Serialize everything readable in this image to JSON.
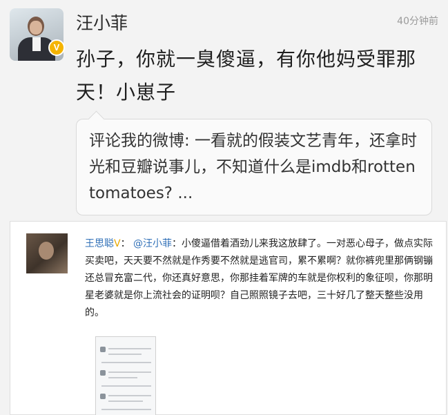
{
  "post": {
    "username": "汪小菲",
    "time": "40分钟前",
    "verified_badge": "V",
    "content": "孙子，你就一臭傻逼，有你他妈受罪那天！小崽子",
    "repost": "评论我的微博: 一看就的假装文艺青年，还拿时光和豆瓣说事儿，不知道什么是imdb和rotten tomatoes? ..."
  },
  "embedded": {
    "username": "王思聪",
    "verified_badge": "V",
    "mention": "@汪小菲",
    "text": "小傻逼借着酒劲儿来我这放肆了。一对恶心母子，做点实际买卖吧，天天要不然就是作秀要不然就是逃官司，累不累啊？就你裤兜里那俩钢镚还总冒充富二代，你还真好意思，你那挂着军牌的车就是你权利的象征呗，你那明星老婆就是你上流社会的证明呗？自己照照镜子去吧，三十好几了整天整些没用的。"
  },
  "colors": {
    "link": "#2f6fb7",
    "badge": "#f5b400",
    "background": "#f3f3f3"
  }
}
